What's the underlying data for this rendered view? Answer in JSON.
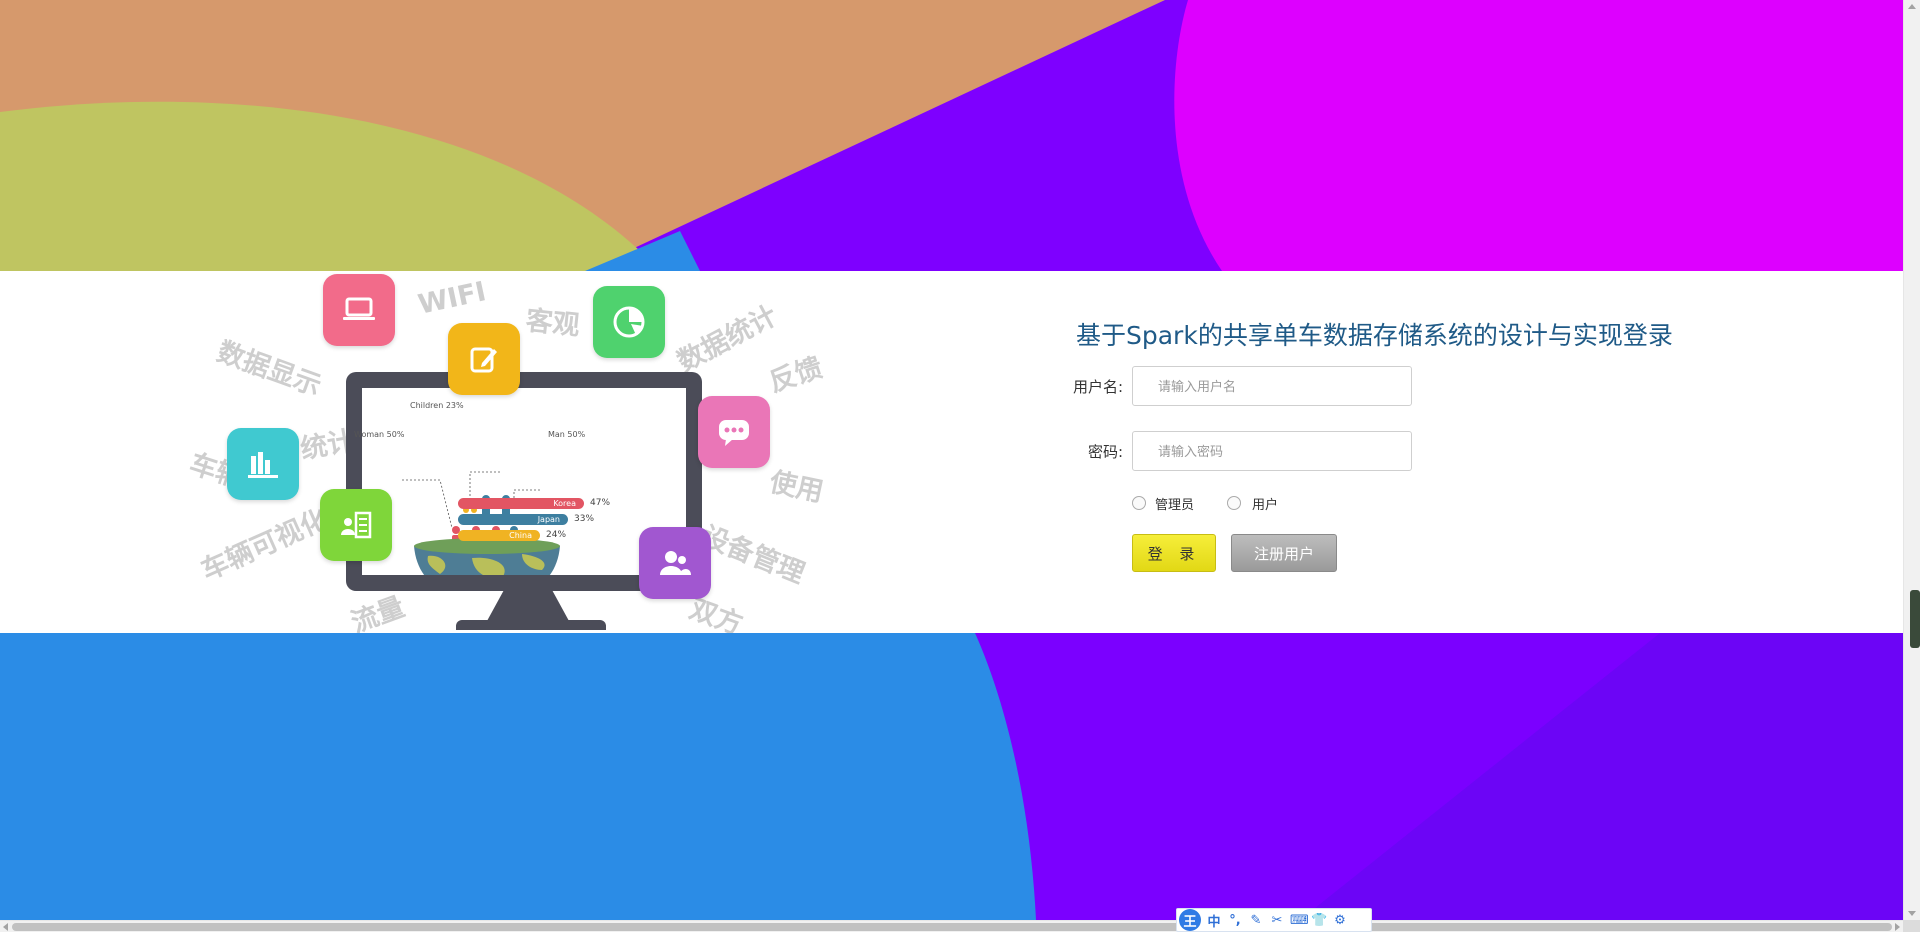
{
  "colors": {
    "top_left": "#d6996c",
    "top_mid": "#7e00ff",
    "top_right": "#dd00ff",
    "olive": "#bfc561",
    "bottom_left": "#2b8ce6",
    "bottom_right": "#7b00ff",
    "title": "#1f5a87",
    "login_button": "#ece421",
    "register_button": "#a8a8a8"
  },
  "illustration": {
    "words": [
      "WIFI",
      "客观",
      "数据统计",
      "反馈",
      "数据显示",
      "统计",
      "车辆",
      "使用",
      "车辆可视化",
      "设备管理",
      "流量",
      "双方"
    ],
    "chart": {
      "children": "Children 23%",
      "woman": "Woman 50%",
      "man": "Man 50%",
      "bars": [
        {
          "label": "Korea",
          "value": "47%"
        },
        {
          "label": "Japan",
          "value": "33%"
        },
        {
          "label": "China",
          "value": "24%"
        }
      ]
    },
    "icons": [
      "laptop-icon",
      "edit-icon",
      "pie-chart-icon",
      "chat-icon",
      "bar-chart-icon",
      "contact-card-icon",
      "users-icon"
    ]
  },
  "login": {
    "title": "基于Spark的共享单车数据存储系统的设计与实现登录",
    "username_label": "用户名:",
    "username_placeholder": "请输入用户名",
    "password_label": "密码:",
    "password_placeholder": "请输入密码",
    "role_admin": "管理员",
    "role_user": "用户",
    "login_button": "登 录",
    "register_button": "注册用户"
  },
  "ime_toolbar": {
    "logo": "王",
    "mode": "中",
    "items": [
      "°,",
      "✎",
      "✂",
      "⌨",
      "👕",
      "⚙"
    ]
  }
}
